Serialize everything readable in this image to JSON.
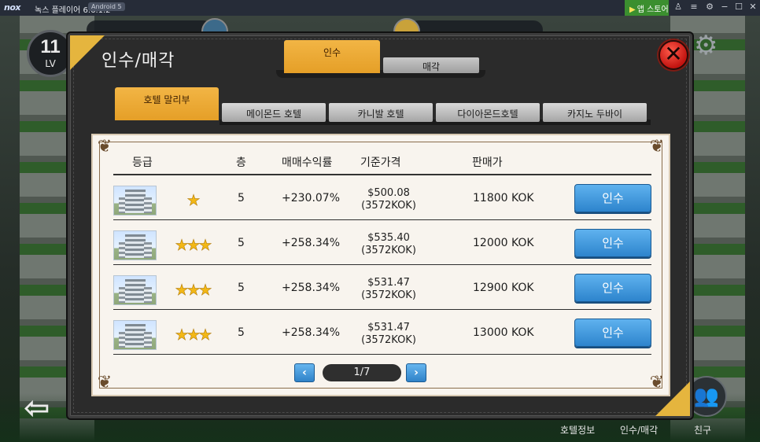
{
  "emulator": {
    "logo": "nox",
    "title": "녹스 플레이어 6.6.1.2",
    "android_badge": "Android 5",
    "store_label": "앱 스토어"
  },
  "background": {
    "level_number": "11",
    "level_label": "LV",
    "bottom_nav": [
      "호텔정보",
      "인수/매각",
      "친구"
    ]
  },
  "modal": {
    "title": "인수/매각",
    "main_tabs": [
      {
        "label": "인수",
        "active": true
      },
      {
        "label": "매각",
        "active": false
      }
    ],
    "hotel_tabs": [
      {
        "label": "호텔 말리부",
        "active": true
      },
      {
        "label": "메이몬드 호텔",
        "active": false
      },
      {
        "label": "카니발 호텔",
        "active": false
      },
      {
        "label": "다이아몬드호텔",
        "active": false
      },
      {
        "label": "카지노 두바이",
        "active": false
      }
    ],
    "table": {
      "headers": {
        "grade": "등급",
        "floor": "층",
        "yield": "매매수익률",
        "base_price": "기준가격",
        "sale_price": "판매가"
      },
      "rows": [
        {
          "stars": "★",
          "floor": "5",
          "yield": "+230.07%",
          "price_usd": "$500.08",
          "price_kok": "(3572KOK)",
          "sale": "11800 KOK",
          "button": "인수"
        },
        {
          "stars": "★★★",
          "floor": "5",
          "yield": "+258.34%",
          "price_usd": "$535.40",
          "price_kok": "(3572KOK)",
          "sale": "12000 KOK",
          "button": "인수"
        },
        {
          "stars": "★★★",
          "floor": "5",
          "yield": "+258.34%",
          "price_usd": "$531.47",
          "price_kok": "(3572KOK)",
          "sale": "12900 KOK",
          "button": "인수"
        },
        {
          "stars": "★★★",
          "floor": "5",
          "yield": "+258.34%",
          "price_usd": "$531.47",
          "price_kok": "(3572KOK)",
          "sale": "13000 KOK",
          "button": "인수"
        }
      ]
    },
    "pagination": {
      "page": "1/7",
      "prev_icon": "chevron-left-icon",
      "next_icon": "chevron-right-icon"
    }
  },
  "colors": {
    "accent_gold": "#e9a932",
    "button_blue": "#3a8fd6",
    "close_red": "#d3241a",
    "star_yellow": "#f3b816"
  }
}
